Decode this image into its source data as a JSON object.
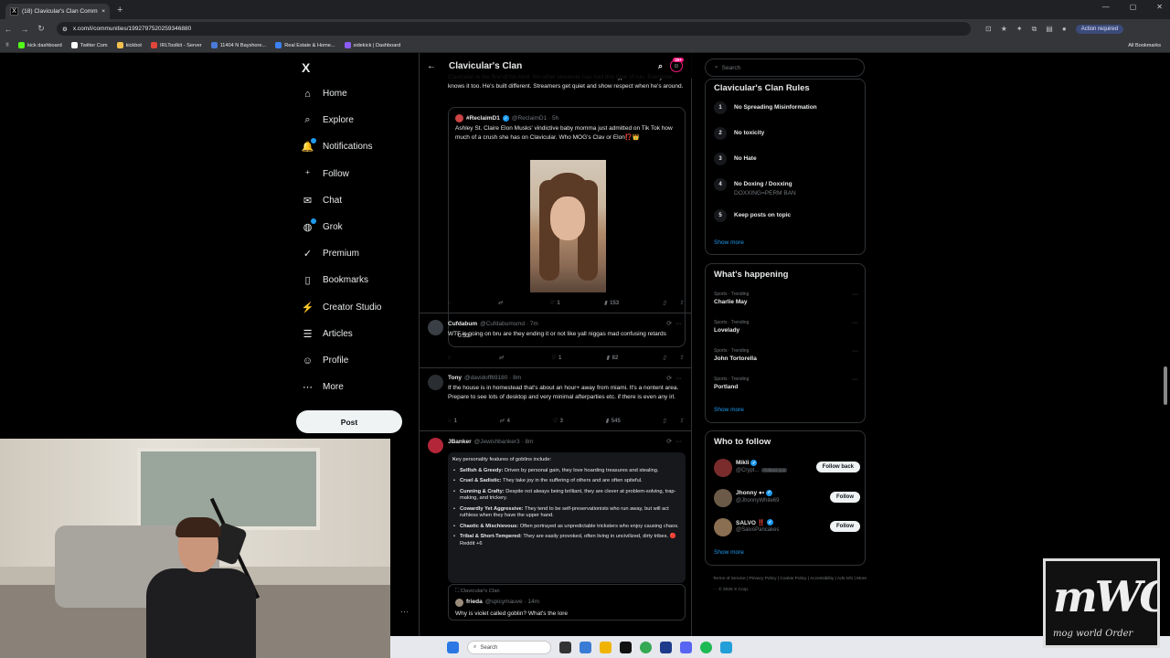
{
  "browser": {
    "tab_title": "(18) Clavicular's Clan Communi",
    "tab_close": "×",
    "new_tab": "+",
    "url": "x.com/i/communities/1992797520259346880",
    "action_required": "Action required",
    "bookmarks": [
      {
        "label": "kick dashboard",
        "color": "#53fc18"
      },
      {
        "label": "Twitter Com",
        "color": "#ffffff"
      },
      {
        "label": "kickbot",
        "color": "#f2c14e"
      },
      {
        "label": "IRLToolkit - Server",
        "color": "#e0463a"
      },
      {
        "label": "11404 N Bayshore...",
        "color": "#4a7bd8"
      },
      {
        "label": "Real Estate & Home...",
        "color": "#3b82f6"
      },
      {
        "label": "sidekick | Dashboard",
        "color": "#8b5cf6"
      }
    ],
    "all_bookmarks": "All Bookmarks"
  },
  "nav": {
    "logo": "X",
    "items": [
      {
        "label": "Home",
        "icon": "home-icon"
      },
      {
        "label": "Explore",
        "icon": "search-icon"
      },
      {
        "label": "Notifications",
        "icon": "bell-icon"
      },
      {
        "label": "Follow",
        "icon": "follow-icon"
      },
      {
        "label": "Chat",
        "icon": "mail-icon"
      },
      {
        "label": "Grok",
        "icon": "grok-icon"
      },
      {
        "label": "Premium",
        "icon": "premium-icon"
      },
      {
        "label": "Bookmarks",
        "icon": "bookmark-icon"
      },
      {
        "label": "Creator Studio",
        "icon": "creator-icon"
      },
      {
        "label": "Articles",
        "icon": "articles-icon"
      },
      {
        "label": "Profile",
        "icon": "profile-icon"
      },
      {
        "label": "More",
        "icon": "more-icon"
      }
    ],
    "post_label": "Post"
  },
  "header": {
    "title": "Clavicular's Clan",
    "badge": "20+"
  },
  "feed": {
    "t1_text": "Clavicular is the first of his kind. No other streamer has had this type of run. Everyone knows it too. He's built different. Streamers get quiet and show respect when he's around.",
    "quote": {
      "name": "#ReclaimD1",
      "handle": "@ReclaimD1 · 5h",
      "text": "Ashley St. Claire Elon Musks' vindictive baby momma just admitted on Tik Tok how much of a crush she has on Clavicular. Who MOG's Clav or Elon⁉️👑",
      "video_time": "0:53"
    },
    "t1_actions": {
      "reply": "",
      "repost": "",
      "like": "1",
      "views": "153"
    },
    "t2": {
      "name": "Cufdabum",
      "handle": "@Cufdabumsmd · 7m",
      "text": "WTF is going on bru are they ending it or not like yall niggas mad confusing retards",
      "actions": {
        "reply": "",
        "repost": "",
        "like": "1",
        "views": "82"
      }
    },
    "t3": {
      "name": "Tony",
      "handle": "@davidoff69180 · 8m",
      "text": "If the house is in homestead that's about an hour+ away from miami. It's a nontent area. Prepare to see lots of desktop and very minimal afterparties etc. if there is even any irl.",
      "actions": {
        "reply": "1",
        "repost": "4",
        "like": "3",
        "views": "545"
      }
    },
    "t4": {
      "name": "JBanker",
      "handle": "@Jewishbanker3 · 8m",
      "intro": "Key personality features of goblins include:",
      "points": [
        {
          "k": "Selfish & Greedy:",
          "v": "Driven by personal gain, they love hoarding treasures and stealing."
        },
        {
          "k": "Cruel & Sadistic:",
          "v": "They take joy in the suffering of others and are often spiteful."
        },
        {
          "k": "Cunning & Crafty:",
          "v": "Despite not always being brilliant, they are clever at problem-solving, trap-making, and trickery."
        },
        {
          "k": "Cowardly Yet Aggressive:",
          "v": "They tend to be self-preservationists who run away, but will act ruthless when they have the upper hand."
        },
        {
          "k": "Chaotic & Mischievous:",
          "v": "Often portrayed as unpredictable tricksters who enjoy causing chaos."
        },
        {
          "k": "Tribal & Short-Tempered:",
          "v": "They are easily provoked, often living in uncivilized, dirty tribes. 🔴 Reddit +6"
        }
      ],
      "inner_community": "Clavicular's Clan",
      "inner_name": "frieda",
      "inner_handle": "@spicymauve · 14m",
      "inner_text": "Why is violet called goblin? What's the lore"
    }
  },
  "sidebar": {
    "search_placeholder": "Search",
    "rules_title": "Clavicular's Clan Rules",
    "rules": [
      {
        "n": "1",
        "t": "No Spreading Misinformation",
        "s": ""
      },
      {
        "n": "2",
        "t": "No toxicity",
        "s": ""
      },
      {
        "n": "3",
        "t": "No Hate",
        "s": ""
      },
      {
        "n": "4",
        "t": "No Doxing / Doxxing",
        "s": "DOXXING=PERM BAN"
      },
      {
        "n": "5",
        "t": "Keep posts on topic",
        "s": ""
      }
    ],
    "show_more": "Show more",
    "happening_title": "What's happening",
    "trends": [
      {
        "cat": "Sports · Trending",
        "name": "Charlie May"
      },
      {
        "cat": "Sports · Trending",
        "name": "Lovelady"
      },
      {
        "cat": "Sports · Trending",
        "name": "John Tortorella"
      },
      {
        "cat": "Sports · Trending",
        "name": "Portland"
      }
    ],
    "who_title": "Who to follow",
    "who": [
      {
        "name": "Mikli",
        "handle": "@Crypt...",
        "note": "Follows you",
        "btn": "Follow back",
        "color": "#7a2b2b"
      },
      {
        "name": "Jhonny ●•",
        "handle": "@JhonnyWhite69",
        "note": "",
        "btn": "Follow",
        "color": "#6b5a48"
      },
      {
        "name": "SALVO ‼️",
        "handle": "@SalvoPancakes",
        "note": "",
        "btn": "Follow",
        "color": "#8a6f52"
      }
    ],
    "footer": "Terms of Service  |  Privacy Policy  |  Cookie Policy  |  Accessibility  |  Ads info  |  More ···  © 2026 X Corp."
  },
  "taskbar": {
    "search": "Search"
  },
  "overlay": {
    "logo": "mWO",
    "sub": "mog world Order"
  }
}
